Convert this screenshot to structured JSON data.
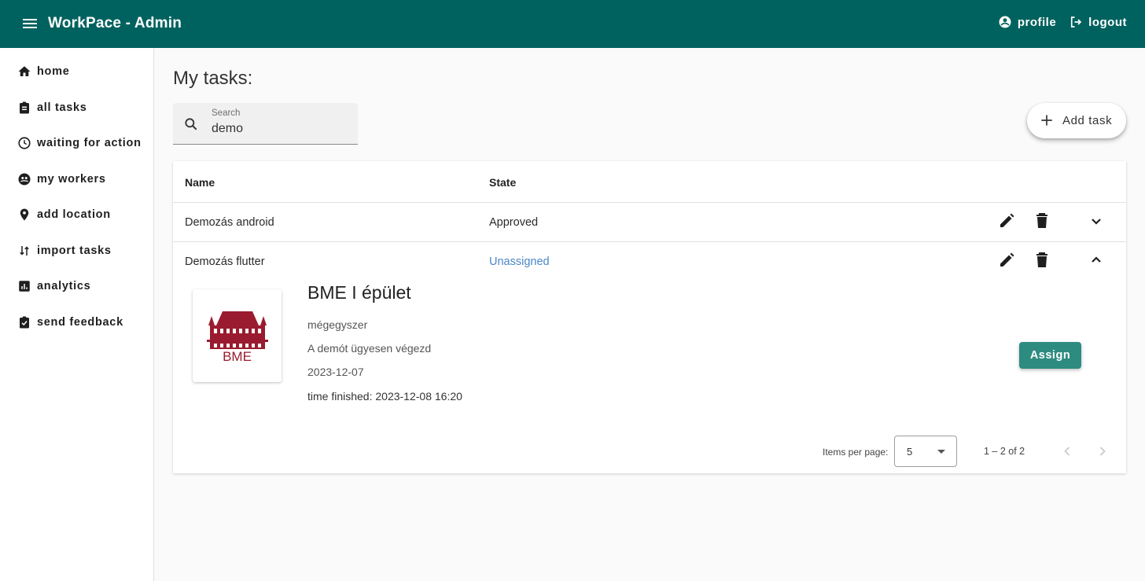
{
  "header": {
    "title": "WorkPace - Admin",
    "profile_label": "profile",
    "logout_label": "logout",
    "color": "#00625f"
  },
  "sidebar": {
    "items": [
      {
        "label": "home",
        "icon": "home-icon"
      },
      {
        "label": "all tasks",
        "icon": "clipboard-icon"
      },
      {
        "label": "waiting for action",
        "icon": "clock-icon"
      },
      {
        "label": "my workers",
        "icon": "workers-icon"
      },
      {
        "label": "add location",
        "icon": "location-pin-icon"
      },
      {
        "label": "import tasks",
        "icon": "import-arrows-icon"
      },
      {
        "label": "analytics",
        "icon": "analytics-icon"
      },
      {
        "label": "send feedback",
        "icon": "feedback-icon"
      }
    ]
  },
  "main": {
    "title": "My tasks:",
    "search": {
      "label": "Search",
      "value": "demo"
    },
    "add_task_label": "Add task"
  },
  "table": {
    "columns": [
      "Name",
      "State"
    ],
    "rows": [
      {
        "name": "Demozás android",
        "state": "Approved",
        "expanded": false
      },
      {
        "name": "Demozás flutter",
        "state": "Unassigned",
        "expanded": true
      }
    ]
  },
  "detail": {
    "title": "BME I épület",
    "subtitle": "mégegyszer",
    "description": "A demót ügyesen végezd",
    "date": "2023-12-07",
    "time_finished": "time finished: 2023-12-08 16:20",
    "logo_text": "BME",
    "assign_label": "Assign",
    "accent_color": "#2e8b80"
  },
  "paginator": {
    "items_per_page_label": "Items per page:",
    "page_size": "5",
    "range": "1 – 2 of 2"
  }
}
